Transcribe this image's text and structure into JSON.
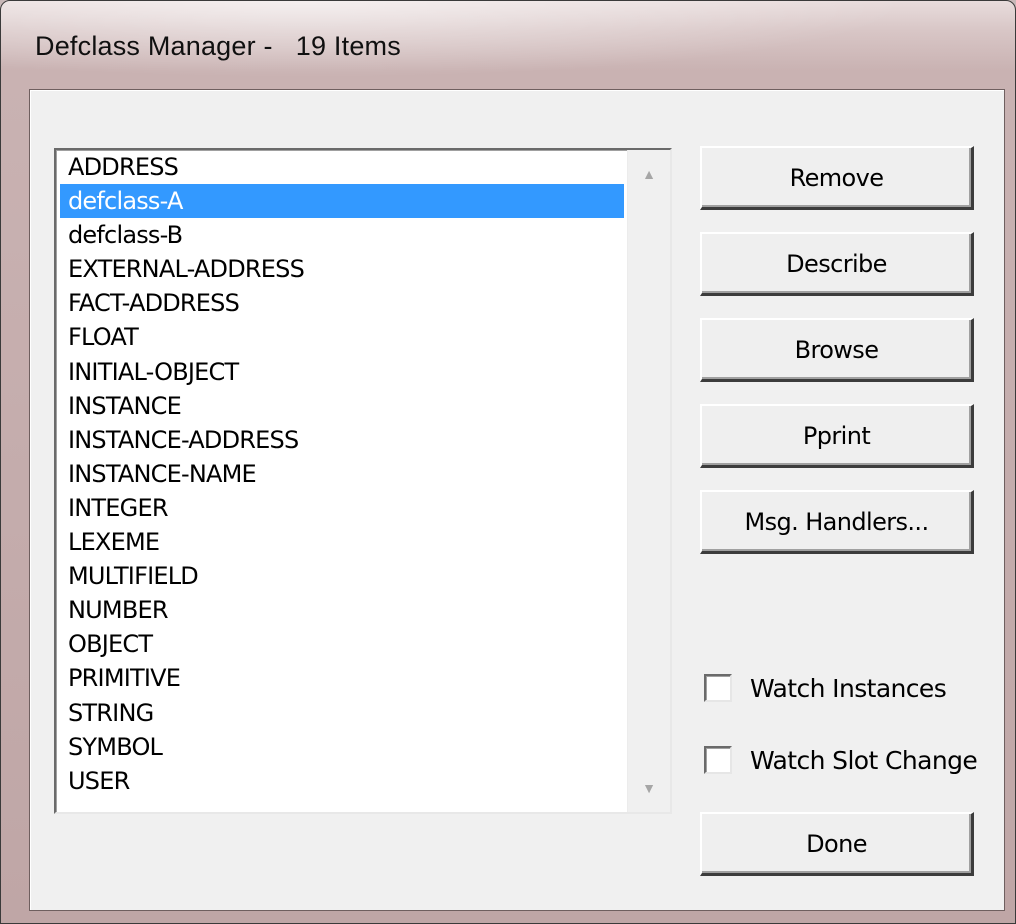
{
  "window": {
    "title": "Defclass Manager -   19 Items"
  },
  "list": {
    "selected_index": 1,
    "items": [
      "ADDRESS",
      "defclass-A",
      "defclass-B",
      "EXTERNAL-ADDRESS",
      "FACT-ADDRESS",
      "FLOAT",
      "INITIAL-OBJECT",
      "INSTANCE",
      "INSTANCE-ADDRESS",
      "INSTANCE-NAME",
      "INTEGER",
      "LEXEME",
      "MULTIFIELD",
      "NUMBER",
      "OBJECT",
      "PRIMITIVE",
      "STRING",
      "SYMBOL",
      "USER"
    ],
    "scroll_up_icon": "▲",
    "scroll_down_icon": "▼"
  },
  "buttons": {
    "remove": "Remove",
    "describe": "Describe",
    "browse": "Browse",
    "pprint": "Pprint",
    "msg_handlers": "Msg. Handlers...",
    "done": "Done"
  },
  "checkboxes": {
    "watch_instances": {
      "label": "Watch Instances",
      "checked": false
    },
    "watch_slot_change": {
      "label": "Watch Slot Change",
      "checked": false
    }
  },
  "colors": {
    "selection_bg": "#3399ff",
    "selection_fg": "#ffffff",
    "dialog_bg": "#f0f0f0"
  }
}
